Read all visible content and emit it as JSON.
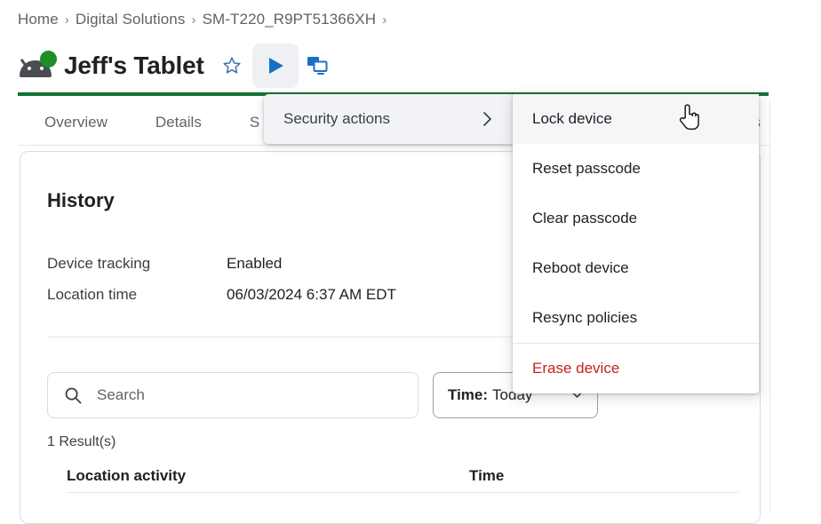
{
  "breadcrumb": {
    "items": [
      "Home",
      "Digital Solutions",
      "SM-T220_R9PT51366XH"
    ],
    "separator": "›",
    "trailing_separator": "›"
  },
  "header": {
    "title": "Jeff's Tablet",
    "device_icon": "android-robot-icon",
    "status_dot_color": "#1e8e29",
    "favorite_icon": "star-outline-icon",
    "play_icon": "play-triangle-icon",
    "remote_view_icon": "screen-mirror-icon",
    "accent_color": "#137333"
  },
  "tabs": [
    {
      "label": "Overview"
    },
    {
      "label": "Details"
    },
    {
      "label": "S"
    },
    {
      "label": "Fields"
    }
  ],
  "card": {
    "title": "History",
    "details": [
      {
        "key": "Device tracking",
        "value": "Enabled"
      },
      {
        "key": "Location time",
        "value": "06/03/2024 6:37 AM EDT"
      }
    ],
    "search": {
      "placeholder": "Search",
      "value": "",
      "icon": "search-icon"
    },
    "time_filter": {
      "label": "Time:",
      "value": "Today",
      "chevron": "chevron-down-icon"
    },
    "result_count": "1 Result(s)",
    "table": {
      "columns": [
        "Location activity",
        "Time"
      ]
    }
  },
  "menus": {
    "parent": {
      "label": "Security actions",
      "chevron": "chevron-right-icon"
    },
    "submenu": {
      "items": [
        {
          "label": "Lock device",
          "state": "highlighted",
          "danger": false
        },
        {
          "label": "Reset passcode",
          "state": "normal",
          "danger": false
        },
        {
          "label": "Clear passcode",
          "state": "normal",
          "danger": false
        },
        {
          "label": "Reboot device",
          "state": "normal",
          "danger": false
        },
        {
          "label": "Resync policies",
          "state": "normal",
          "danger": false
        },
        {
          "label": "Erase device",
          "state": "normal",
          "danger": true
        }
      ],
      "danger_color": "#c5221f"
    }
  },
  "cursor": {
    "type": "pointing-hand-cursor"
  }
}
